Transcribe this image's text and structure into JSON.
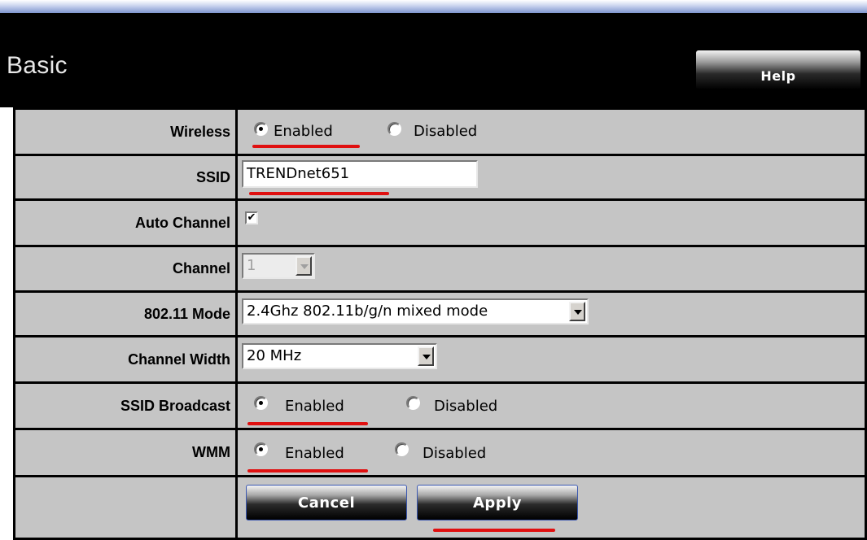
{
  "header": {
    "title": "Basic",
    "help_label": "Help"
  },
  "form": {
    "wireless": {
      "label": "Wireless",
      "enabled": "Enabled",
      "disabled": "Disabled",
      "selected": "Enabled"
    },
    "ssid": {
      "label": "SSID",
      "value": "TRENDnet651"
    },
    "auto_channel": {
      "label": "Auto Channel",
      "checked": true,
      "mark": "✔"
    },
    "channel": {
      "label": "Channel",
      "value": "1"
    },
    "mode": {
      "label": "802.11 Mode",
      "value": "2.4Ghz 802.11b/g/n mixed mode"
    },
    "channel_width": {
      "label": "Channel Width",
      "value": "20 MHz"
    },
    "ssid_broadcast": {
      "label": "SSID Broadcast",
      "enabled": "Enabled",
      "disabled": "Disabled",
      "selected": "Enabled"
    },
    "wmm": {
      "label": "WMM",
      "enabled": "Enabled",
      "disabled": "Disabled",
      "selected": "Enabled"
    }
  },
  "buttons": {
    "cancel": "Cancel",
    "apply": "Apply"
  },
  "colors": {
    "annotation": "#e01010",
    "row_bg": "#c5c5c5",
    "header_bg": "#000000"
  }
}
